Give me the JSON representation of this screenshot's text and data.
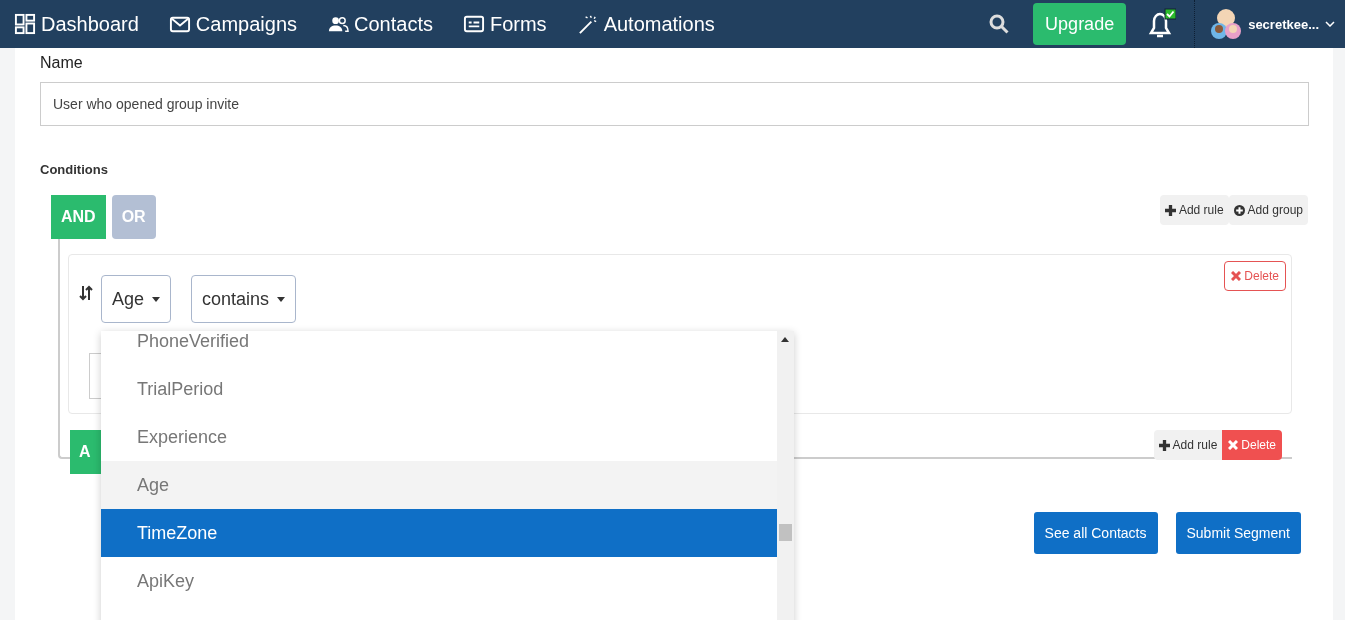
{
  "nav": {
    "items": [
      "Dashboard",
      "Campaigns",
      "Contacts",
      "Forms",
      "Automations"
    ],
    "upgrade": "Upgrade",
    "user": "secretkee..."
  },
  "form": {
    "name_label": "Name",
    "name_value": "User who opened group invite",
    "conditions_label": "Conditions"
  },
  "group": {
    "combinators": [
      {
        "label": "AND",
        "selected": true
      },
      {
        "label": "OR",
        "selected": false
      }
    ],
    "add_rule": "Add rule",
    "add_group": "Add group",
    "rule": {
      "field": "Age",
      "operator": "contains",
      "delete": "Delete"
    },
    "subgroup": {
      "combinator": "A",
      "add_rule": "Add rule",
      "delete": "Delete"
    }
  },
  "dropdown": {
    "options": [
      {
        "label": "PhoneVerified",
        "hovered": false,
        "selected": false
      },
      {
        "label": "TrialPeriod",
        "hovered": false,
        "selected": false
      },
      {
        "label": "Experience",
        "hovered": false,
        "selected": false
      },
      {
        "label": "Age",
        "hovered": true,
        "selected": false
      },
      {
        "label": "TimeZone",
        "hovered": false,
        "selected": true
      },
      {
        "label": "ApiKey",
        "hovered": false,
        "selected": false
      }
    ]
  },
  "actions": [
    "See all Contacts",
    "Submit Segment"
  ]
}
